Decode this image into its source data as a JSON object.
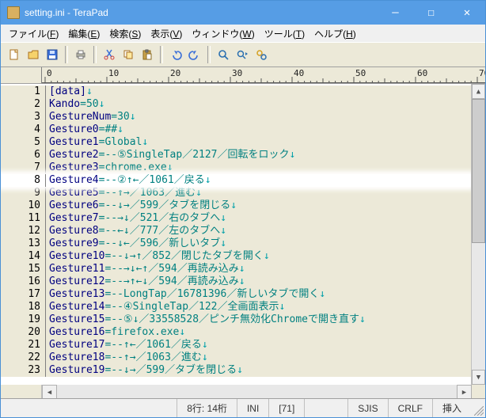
{
  "titlebar": {
    "icon": "terapad-icon",
    "title": "setting.ini - TeraPad"
  },
  "winbuttons": {
    "min": "—",
    "max": "☐",
    "close": "✕"
  },
  "menu": [
    {
      "jp": "ファイル",
      "u": "F"
    },
    {
      "jp": "編集",
      "u": "E"
    },
    {
      "jp": "検索",
      "u": "S"
    },
    {
      "jp": "表示",
      "u": "V"
    },
    {
      "jp": "ウィンドウ",
      "u": "W"
    },
    {
      "jp": "ツール",
      "u": "T"
    },
    {
      "jp": "ヘルプ",
      "u": "H"
    }
  ],
  "ruler": {
    "marks": [
      0,
      10,
      20,
      30,
      40,
      50,
      60
    ]
  },
  "lines": [
    {
      "n": 1,
      "seg": [
        {
          "t": "[data]",
          "c": "str"
        }
      ],
      "eol": "↓"
    },
    {
      "n": 2,
      "seg": [
        {
          "t": "Kando",
          "c": "kw"
        },
        {
          "t": "=",
          "c": "op"
        },
        {
          "t": "50",
          "c": "num"
        }
      ],
      "eol": "↓"
    },
    {
      "n": 3,
      "seg": [
        {
          "t": "GestureNum",
          "c": "kw"
        },
        {
          "t": "=",
          "c": "op"
        },
        {
          "t": "30",
          "c": "num"
        }
      ],
      "eol": "↓"
    },
    {
      "n": 4,
      "seg": [
        {
          "t": "Gesture0",
          "c": "kw"
        },
        {
          "t": "=",
          "c": "op"
        },
        {
          "t": "##",
          "c": "num"
        }
      ],
      "eol": "↓"
    },
    {
      "n": 5,
      "seg": [
        {
          "t": "Gesture1",
          "c": "kw"
        },
        {
          "t": "=",
          "c": "op"
        },
        {
          "t": "Global",
          "c": "num"
        }
      ],
      "eol": "↓"
    },
    {
      "n": 6,
      "seg": [
        {
          "t": "Gesture2",
          "c": "kw"
        },
        {
          "t": "=",
          "c": "op"
        },
        {
          "t": "--⑤SingleTap／2127／回転をロック",
          "c": "num"
        }
      ],
      "eol": "↓"
    },
    {
      "n": 7,
      "seg": [
        {
          "t": "Gesture3",
          "c": "kw"
        },
        {
          "t": "=",
          "c": "op"
        },
        {
          "t": "chrome.exe",
          "c": "num"
        }
      ],
      "eol": "↓"
    },
    {
      "n": 8,
      "seg": [
        {
          "t": "Gesture4",
          "c": "kw"
        },
        {
          "t": "=",
          "c": "op"
        },
        {
          "t": "--②↑←／1061／戻る",
          "c": "num"
        }
      ],
      "eol": "↓",
      "emph": true
    },
    {
      "n": 9,
      "seg": [
        {
          "t": "Gesture5",
          "c": "kw"
        },
        {
          "t": "=",
          "c": "op"
        },
        {
          "t": "--↑→／1063／進む",
          "c": "num"
        }
      ],
      "eol": "↓"
    },
    {
      "n": 10,
      "seg": [
        {
          "t": "Gesture6",
          "c": "kw"
        },
        {
          "t": "=",
          "c": "op"
        },
        {
          "t": "--↓→／599／タブを閉じる",
          "c": "num"
        }
      ],
      "eol": "↓"
    },
    {
      "n": 11,
      "seg": [
        {
          "t": "Gesture7",
          "c": "kw"
        },
        {
          "t": "=",
          "c": "op"
        },
        {
          "t": "--→↓／521／右のタブへ",
          "c": "num"
        }
      ],
      "eol": "↓"
    },
    {
      "n": 12,
      "seg": [
        {
          "t": "Gesture8",
          "c": "kw"
        },
        {
          "t": "=",
          "c": "op"
        },
        {
          "t": "--←↓／777／左のタブへ",
          "c": "num"
        }
      ],
      "eol": "↓"
    },
    {
      "n": 13,
      "seg": [
        {
          "t": "Gesture9",
          "c": "kw"
        },
        {
          "t": "=",
          "c": "op"
        },
        {
          "t": "--↓←／596／新しいタブ",
          "c": "num"
        }
      ],
      "eol": "↓"
    },
    {
      "n": 14,
      "seg": [
        {
          "t": "Gesture10",
          "c": "kw"
        },
        {
          "t": "=",
          "c": "op"
        },
        {
          "t": "--↓→↑／852／閉じたタブを開く",
          "c": "num"
        }
      ],
      "eol": "↓"
    },
    {
      "n": 15,
      "seg": [
        {
          "t": "Gesture11",
          "c": "kw"
        },
        {
          "t": "=",
          "c": "op"
        },
        {
          "t": "--→↓←↑／594／再読み込み",
          "c": "num"
        }
      ],
      "eol": "↓"
    },
    {
      "n": 16,
      "seg": [
        {
          "t": "Gesture12",
          "c": "kw"
        },
        {
          "t": "=",
          "c": "op"
        },
        {
          "t": "--→↑←↓／594／再読み込み",
          "c": "num"
        }
      ],
      "eol": "↓"
    },
    {
      "n": 17,
      "seg": [
        {
          "t": "Gesture13",
          "c": "kw"
        },
        {
          "t": "=",
          "c": "op"
        },
        {
          "t": "--LongTap／16781396／新しいタブで開く",
          "c": "num"
        }
      ],
      "eol": "↓"
    },
    {
      "n": 18,
      "seg": [
        {
          "t": "Gesture14",
          "c": "kw"
        },
        {
          "t": "=",
          "c": "op"
        },
        {
          "t": "--④SingleTap／122／全画面表示",
          "c": "num"
        }
      ],
      "eol": "↓"
    },
    {
      "n": 19,
      "seg": [
        {
          "t": "Gesture15",
          "c": "kw"
        },
        {
          "t": "=",
          "c": "op"
        },
        {
          "t": "--⑤↓／33558528／ピンチ無効化Chromeで開き直す",
          "c": "num"
        }
      ],
      "eol": "↓"
    },
    {
      "n": 20,
      "seg": [
        {
          "t": "Gesture16",
          "c": "kw"
        },
        {
          "t": "=",
          "c": "op"
        },
        {
          "t": "firefox.exe",
          "c": "num"
        }
      ],
      "eol": "↓"
    },
    {
      "n": 21,
      "seg": [
        {
          "t": "Gesture17",
          "c": "kw"
        },
        {
          "t": "=",
          "c": "op"
        },
        {
          "t": "--↑←／1061／戻る",
          "c": "num"
        }
      ],
      "eol": "↓"
    },
    {
      "n": 22,
      "seg": [
        {
          "t": "Gesture18",
          "c": "kw"
        },
        {
          "t": "=",
          "c": "op"
        },
        {
          "t": "--↑→／1063／進む",
          "c": "num"
        }
      ],
      "eol": "↓"
    },
    {
      "n": 23,
      "seg": [
        {
          "t": "Gesture19",
          "c": "kw"
        },
        {
          "t": "=",
          "c": "op"
        },
        {
          "t": "--↓→／599／タブを閉じる",
          "c": "num"
        }
      ],
      "eol": "↓"
    }
  ],
  "status": {
    "pos": "8行: 14桁",
    "mode": "INI",
    "code": "[71]",
    "enc": "SJIS",
    "lf": "CRLF",
    "ins": "挿入"
  }
}
